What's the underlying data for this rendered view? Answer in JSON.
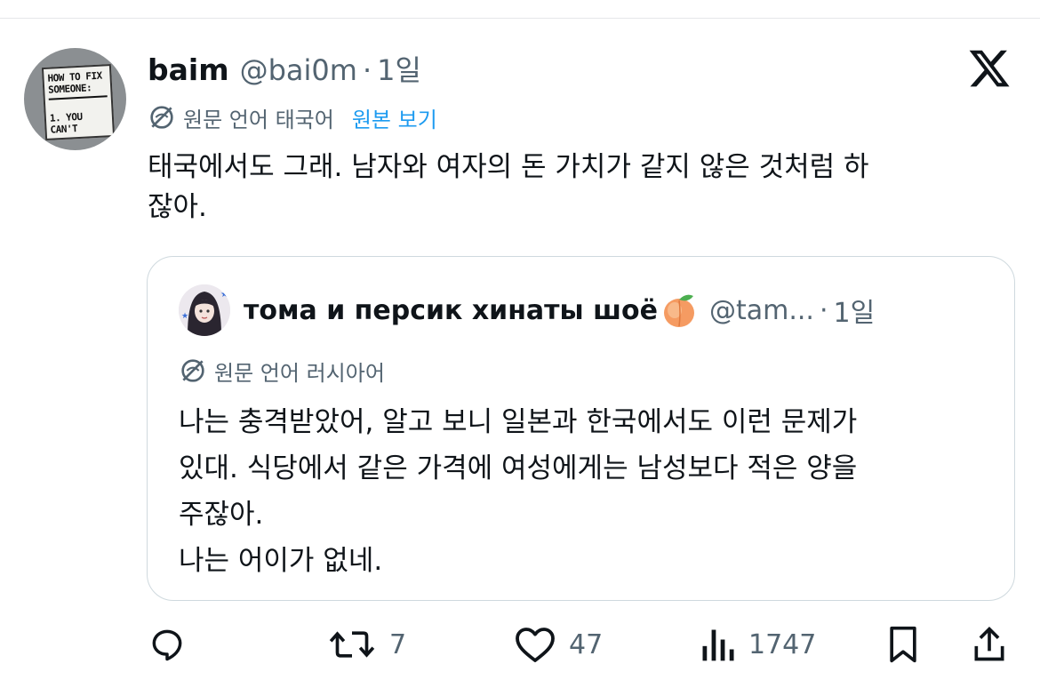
{
  "tweet": {
    "author_name": "baim",
    "handle": "@bai0m",
    "separator": "·",
    "time": "1일",
    "avatar_sign": [
      "HOW TO FIX",
      "SOMEONE:",
      "1. YOU CAN'T"
    ],
    "translation_label": "원문 언어 태국어",
    "translation_link": "원본 보기",
    "text_lines": [
      "태국에서도 그래. 남자와 여자의 돈 가치가 같지 않은 것처럼 하",
      "잖아."
    ]
  },
  "quote": {
    "author_name": "тома и персик хинаты шоё",
    "emoji": "peach-emoji",
    "handle": "@tam...",
    "separator": "·",
    "time": "1일",
    "translation_label": "원문 언어 러시아어",
    "text_lines": [
      "나는 충격받았어, 알고 보니 일본과 한국에서도 이런 문제가",
      "있대. 식당에서 같은 가격에 여성에게는 남성보다 적은 양을",
      "주잖아.",
      "나는 어이가 없네."
    ]
  },
  "actions": {
    "reply_icon": "reply-icon",
    "retweet_icon": "retweet-icon",
    "retweet_count": "7",
    "like_icon": "heart-icon",
    "like_count": "47",
    "views_icon": "views-chart-icon",
    "views_count": "1747",
    "bookmark_icon": "bookmark-icon",
    "share_icon": "share-icon"
  },
  "colors": {
    "text": "#0f1419",
    "muted": "#536471",
    "link": "#1d9bf0",
    "border": "#cfd9de"
  }
}
